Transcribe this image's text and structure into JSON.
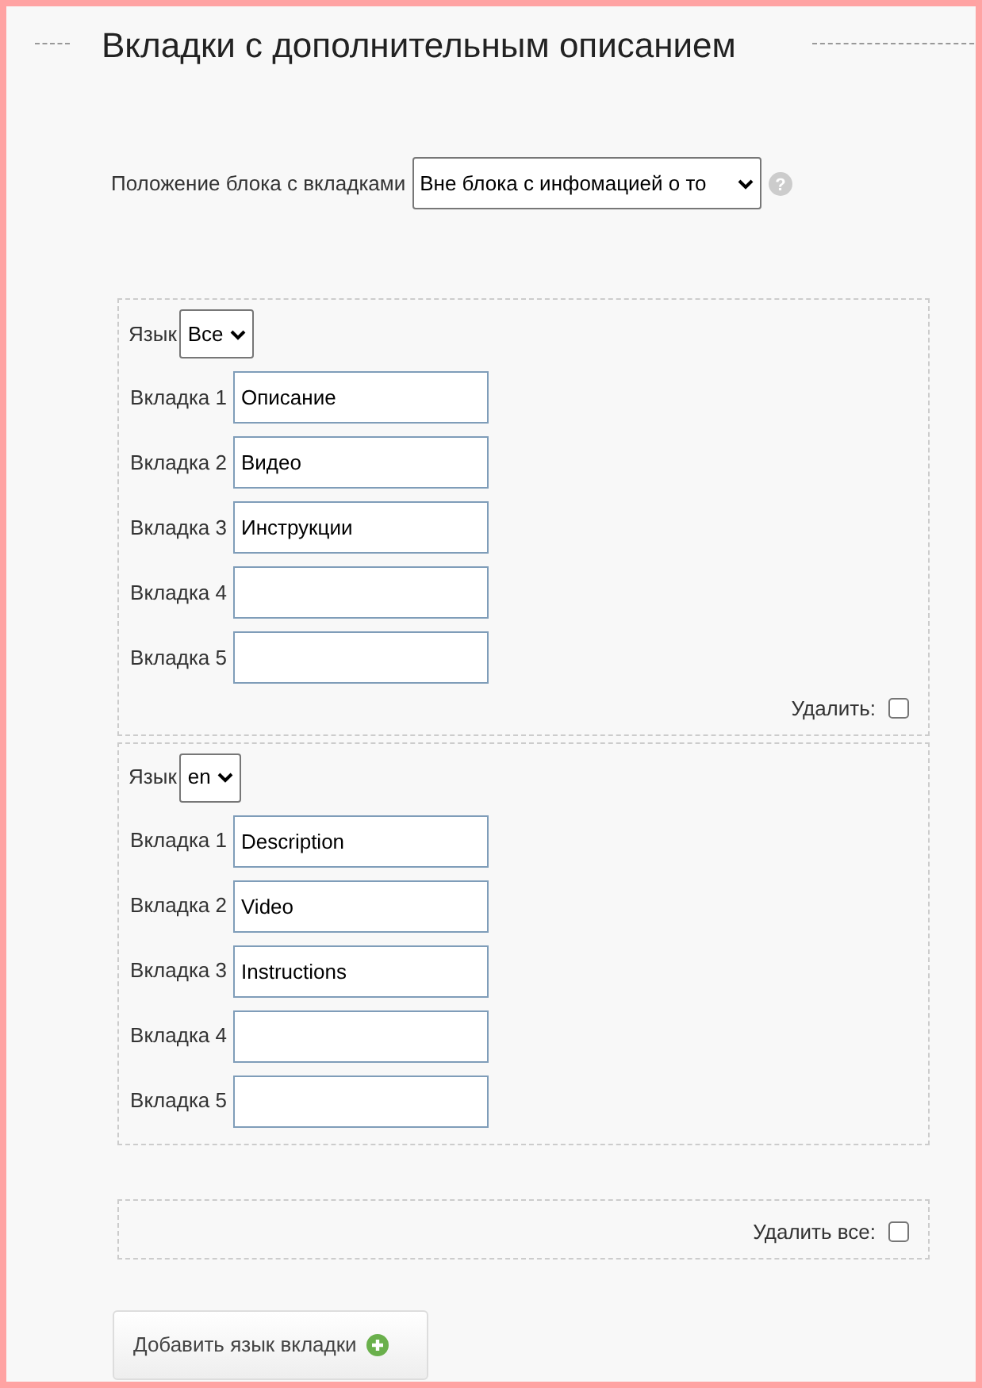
{
  "section": {
    "title": "Вкладки с дополнительным описанием"
  },
  "position": {
    "label": "Положение блока с вкладками",
    "value": "Вне блока с инфомацией о то",
    "help": "?"
  },
  "groups": [
    {
      "language_label": "Язык",
      "language": "Все",
      "tabs": [
        {
          "label": "Вкладка 1",
          "value": "Описание"
        },
        {
          "label": "Вкладка 2",
          "value": "Видео"
        },
        {
          "label": "Вкладка 3",
          "value": "Инструкции"
        },
        {
          "label": "Вкладка 4"
        },
        {
          "label": "Вкладка 5"
        }
      ],
      "delete": {
        "label": "Удалить:",
        "checked": false
      }
    },
    {
      "language_label": "Язык",
      "language": "en",
      "tabs": [
        {
          "label": "Вкладка 1",
          "value": "Description"
        },
        {
          "label": "Вкладка 2",
          "value": "Video"
        },
        {
          "label": "Вкладка 3",
          "value": "Instructions"
        },
        {
          "label": "Вкладка 4"
        },
        {
          "label": "Вкладка 5"
        }
      ]
    }
  ],
  "delete_all": {
    "label": "Удалить все:",
    "checked": false
  },
  "add_button": {
    "label": "Добавить язык вкладки"
  }
}
